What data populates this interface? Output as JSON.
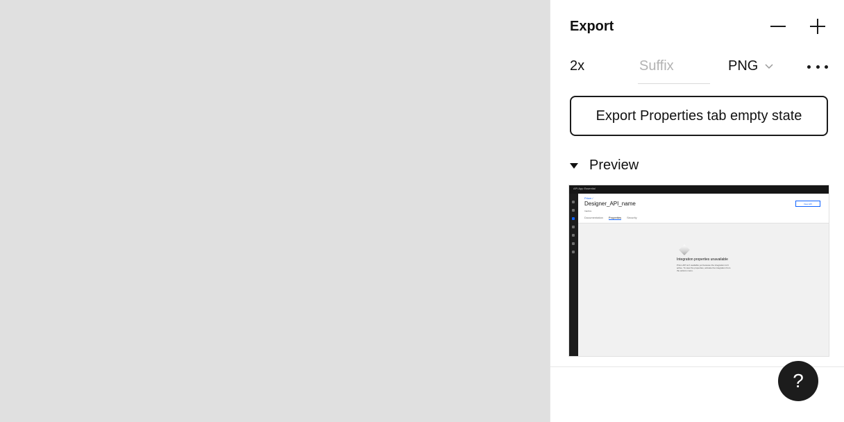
{
  "export_panel": {
    "title": "Export",
    "scale": "2x",
    "suffix_placeholder": "Suffix",
    "suffix_value": "",
    "format": "PNG",
    "export_button_label": "Export Properties tab empty state",
    "preview_label": "Preview"
  },
  "help": {
    "label": "?"
  },
  "preview_thumbnail": {
    "top_bar_label": "API App Essential",
    "breadcrumb": "Prism /",
    "name": "Designer_API_name",
    "status": "Inactive",
    "tabs": [
      "Documentation",
      "Properties",
      "Security"
    ],
    "action_button": "View API",
    "empty_title": "Integration properties unavailable",
    "empty_body": "Prism API isn't available yet because the integration isn't active. To view the properties, activate the integration from the actions menu."
  },
  "colors": {
    "canvas": "#e0e0e0",
    "panel": "#ffffff",
    "text": "#111111",
    "placeholder": "#b3b3b3",
    "help_button": "#1c1c1c"
  }
}
